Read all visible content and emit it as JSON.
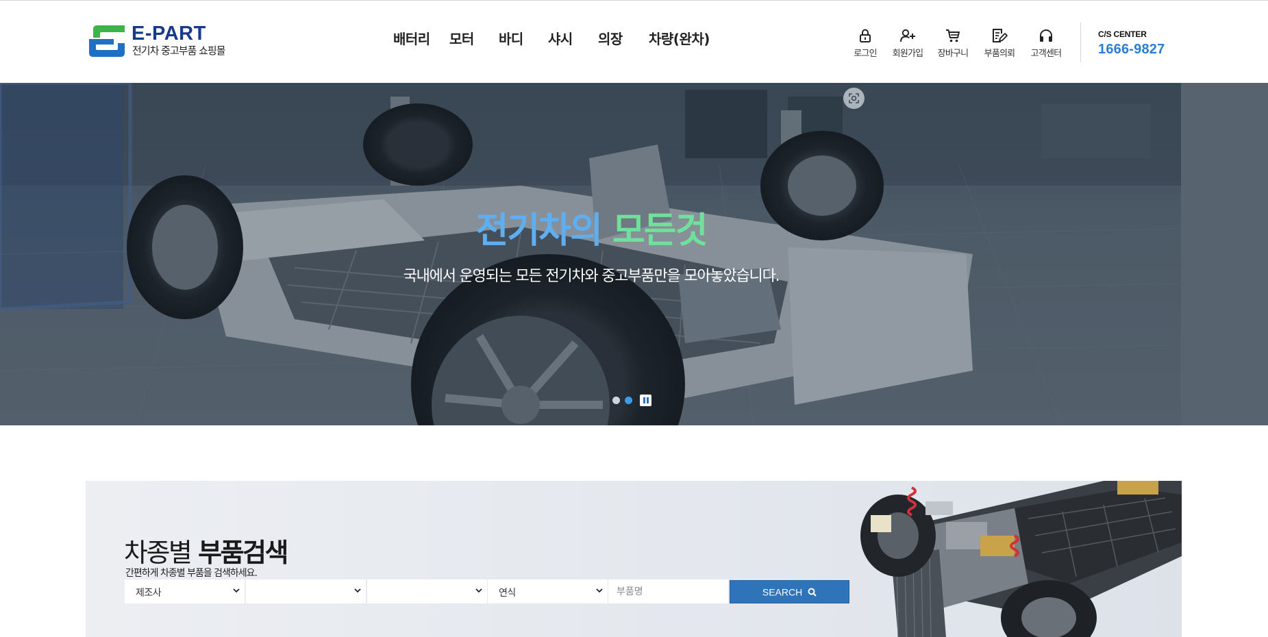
{
  "header": {
    "logo": {
      "title": "E-PART",
      "subtitle": "전기차 중고부품 쇼핑몰",
      "colors": {
        "green": "#3bb54a",
        "blue": "#1f6fc4"
      }
    },
    "nav": [
      {
        "label": "배터리"
      },
      {
        "label": "모터"
      },
      {
        "label": "바디"
      },
      {
        "label": "샤시"
      },
      {
        "label": "의장"
      },
      {
        "label": "차량(완차)"
      }
    ],
    "utility": [
      {
        "label": "로그인",
        "icon": "lock-icon"
      },
      {
        "label": "회원가입",
        "icon": "user-add-icon"
      },
      {
        "label": "장바구니",
        "icon": "cart-icon"
      },
      {
        "label": "부품의뢰",
        "icon": "edit-document-icon"
      },
      {
        "label": "고객센터",
        "icon": "headset-icon"
      }
    ],
    "cs_center": {
      "label": "C/S CENTER",
      "phone": "1666-9827"
    }
  },
  "hero": {
    "title_part1": "전기차의",
    "title_part2": "모든것",
    "subtitle": "국내에서 운영되는 모든 전기차와 중고부품만을 모아놓았습니다.",
    "colors": {
      "title_blue": "#5eaef2",
      "title_green": "#6fe19a"
    },
    "slides_total": 2,
    "active_slide": 2
  },
  "part_search": {
    "title_light": "차종별",
    "title_bold": "부품검색",
    "description": "간편하게 차종별 부품을 검색하세요.",
    "selects": [
      {
        "value": "제조사"
      },
      {
        "value": ""
      },
      {
        "value": ""
      },
      {
        "value": "연식"
      }
    ],
    "part_placeholder": "부품명",
    "button_label": "SEARCH",
    "button_color": "#2f73b8"
  }
}
